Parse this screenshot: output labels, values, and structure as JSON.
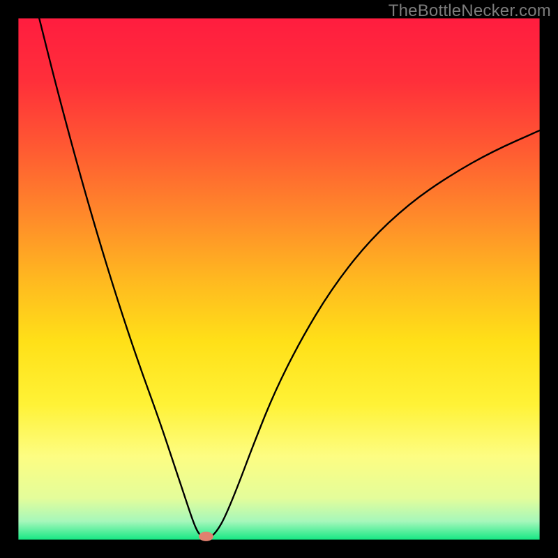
{
  "watermark": "TheBottleNecker.com",
  "chart_data": {
    "type": "line",
    "title": "",
    "xlabel": "",
    "ylabel": "",
    "xlim": [
      0,
      100
    ],
    "ylim": [
      0,
      100
    ],
    "background": {
      "type": "vertical-gradient",
      "stops": [
        {
          "pos": 0.0,
          "color": "#ff1d3f"
        },
        {
          "pos": 0.12,
          "color": "#ff2f3a"
        },
        {
          "pos": 0.25,
          "color": "#ff5a32"
        },
        {
          "pos": 0.38,
          "color": "#ff8a2a"
        },
        {
          "pos": 0.5,
          "color": "#ffb820"
        },
        {
          "pos": 0.62,
          "color": "#ffe018"
        },
        {
          "pos": 0.74,
          "color": "#fff236"
        },
        {
          "pos": 0.84,
          "color": "#fdfd82"
        },
        {
          "pos": 0.92,
          "color": "#e4fd9a"
        },
        {
          "pos": 0.965,
          "color": "#a6f7bb"
        },
        {
          "pos": 1.0,
          "color": "#17e884"
        }
      ]
    },
    "series": [
      {
        "name": "bottleneck-curve",
        "stroke": "#000000",
        "points": [
          {
            "x": 4.0,
            "y": 100.0
          },
          {
            "x": 7.0,
            "y": 88.0
          },
          {
            "x": 11.0,
            "y": 73.0
          },
          {
            "x": 15.0,
            "y": 59.0
          },
          {
            "x": 19.0,
            "y": 46.0
          },
          {
            "x": 23.0,
            "y": 34.0
          },
          {
            "x": 27.0,
            "y": 23.0
          },
          {
            "x": 30.0,
            "y": 14.0
          },
          {
            "x": 32.0,
            "y": 8.0
          },
          {
            "x": 33.5,
            "y": 3.5
          },
          {
            "x": 34.5,
            "y": 1.2
          },
          {
            "x": 35.5,
            "y": 0.4
          },
          {
            "x": 36.8,
            "y": 0.4
          },
          {
            "x": 38.0,
            "y": 1.5
          },
          {
            "x": 39.5,
            "y": 4.0
          },
          {
            "x": 42.0,
            "y": 10.0
          },
          {
            "x": 45.0,
            "y": 18.0
          },
          {
            "x": 49.0,
            "y": 28.0
          },
          {
            "x": 54.0,
            "y": 38.0
          },
          {
            "x": 60.0,
            "y": 48.0
          },
          {
            "x": 67.0,
            "y": 57.0
          },
          {
            "x": 75.0,
            "y": 64.5
          },
          {
            "x": 83.0,
            "y": 70.0
          },
          {
            "x": 91.0,
            "y": 74.5
          },
          {
            "x": 100.0,
            "y": 78.5
          }
        ]
      }
    ],
    "marker": {
      "name": "optimal-point",
      "x": 36.0,
      "y": 0.6,
      "rx": 1.4,
      "ry": 0.9,
      "fill": "#e2806f"
    },
    "frame": {
      "inner_margin_pct": 3.3,
      "border_color": "#000000"
    }
  }
}
